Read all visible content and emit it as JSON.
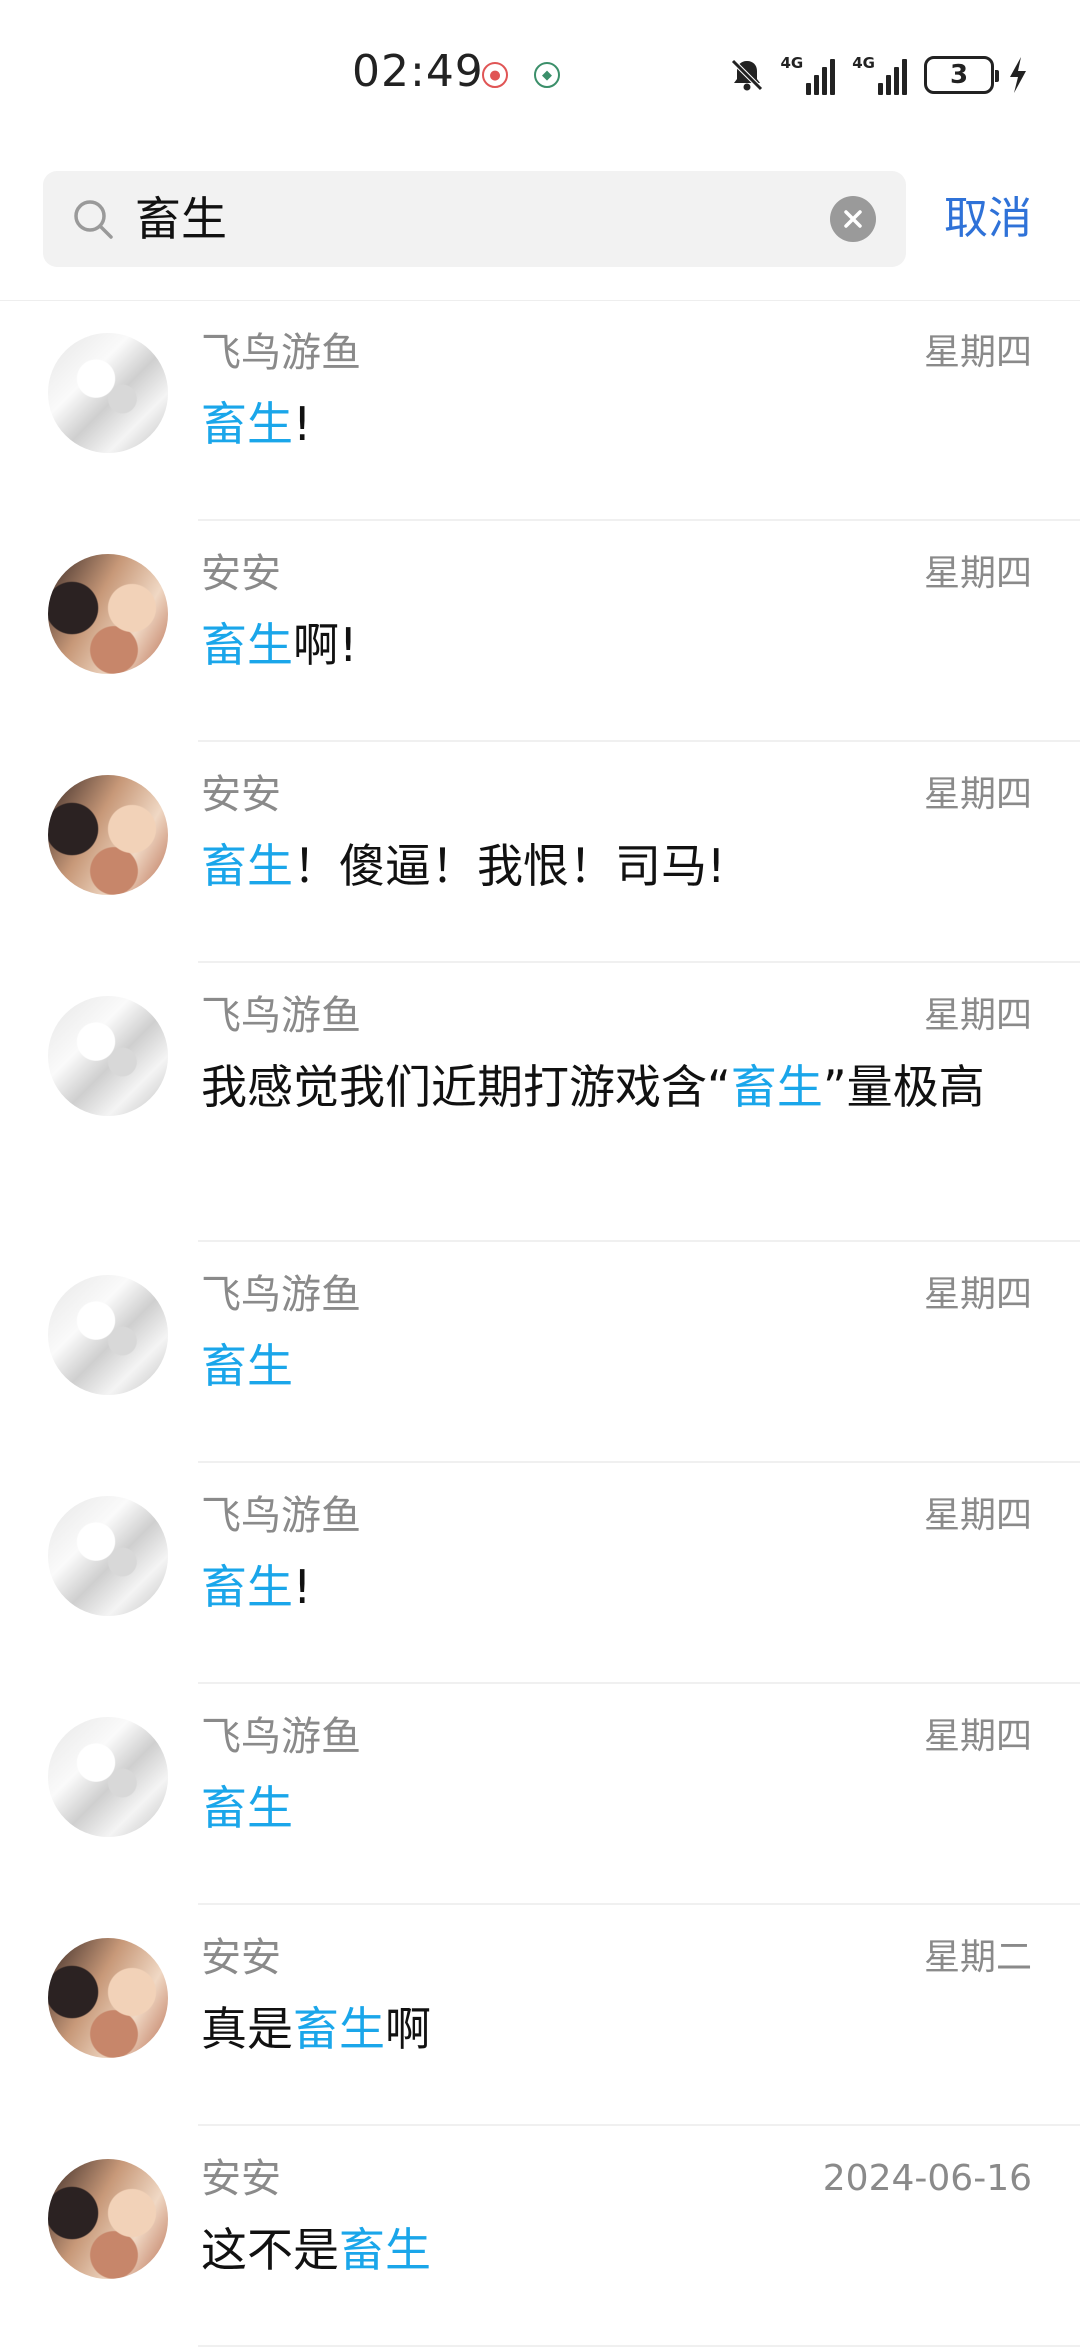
{
  "status_bar": {
    "time": "02:49",
    "signal_1_label": "4G",
    "signal_2_label": "4G",
    "battery_level": "3"
  },
  "search": {
    "query": "畜生",
    "cancel_label": "取消"
  },
  "results": [
    {
      "avatar": "white",
      "name": "飞鸟游鱼",
      "date": "星期四",
      "before": "",
      "highlight": "畜生",
      "after": "!"
    },
    {
      "avatar": "warm",
      "name": "安安",
      "date": "星期四",
      "before": "",
      "highlight": "畜生",
      "after": "啊!"
    },
    {
      "avatar": "warm",
      "name": "安安",
      "date": "星期四",
      "before": "",
      "highlight": "畜生",
      "after": "！傻逼！我恨！司马!"
    },
    {
      "avatar": "white",
      "name": "飞鸟游鱼",
      "date": "星期四",
      "before": "我感觉我们近期打游戏含“",
      "highlight": "畜生",
      "after": "”量极高"
    },
    {
      "avatar": "white",
      "name": "飞鸟游鱼",
      "date": "星期四",
      "before": "",
      "highlight": "畜生",
      "after": ""
    },
    {
      "avatar": "white",
      "name": "飞鸟游鱼",
      "date": "星期四",
      "before": "",
      "highlight": "畜生",
      "after": "!"
    },
    {
      "avatar": "white",
      "name": "飞鸟游鱼",
      "date": "星期四",
      "before": "",
      "highlight": "畜生",
      "after": ""
    },
    {
      "avatar": "warm",
      "name": "安安",
      "date": "星期二",
      "before": "真是",
      "highlight": "畜生",
      "after": "啊"
    },
    {
      "avatar": "warm",
      "name": "安安",
      "date": "2024-06-16",
      "before": "这不是",
      "highlight": "畜生",
      "after": ""
    }
  ]
}
